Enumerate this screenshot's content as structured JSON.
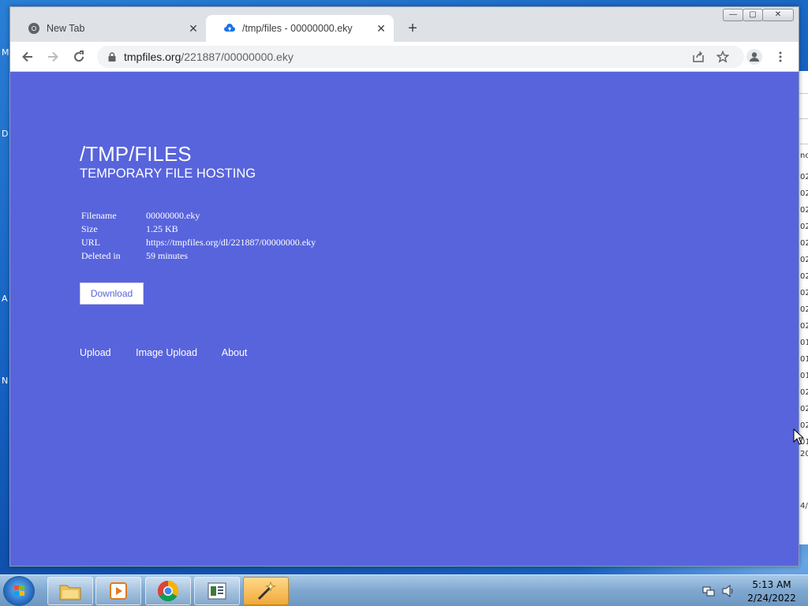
{
  "browser": {
    "tabs": [
      {
        "label": "New Tab",
        "icon": "chrome-icon"
      },
      {
        "label": "/tmp/files - 00000000.eky",
        "icon": "cloud-upload-icon",
        "active": true
      }
    ],
    "new_tab_label": "+",
    "url_domain": "tmpfiles.org",
    "url_path": "/221887/00000000.eky",
    "window_controls": [
      "minimize",
      "maximize",
      "close"
    ]
  },
  "page": {
    "title": "/TMP/FILES",
    "subtitle": "TEMPORARY FILE HOSTING",
    "file_info": [
      {
        "key": "Filename",
        "value": "00000000.eky"
      },
      {
        "key": "Size",
        "value": "1.25 KB"
      },
      {
        "key": "URL",
        "value": "https://tmpfiles.org/dl/221887/00000000.eky"
      },
      {
        "key": "Deleted in",
        "value": "59 minutes"
      }
    ],
    "download_label": "Download",
    "nav": [
      "Upload",
      "Image Upload",
      "About"
    ],
    "background_color": "#5864dc"
  },
  "taskbar": {
    "items": [
      "file-explorer-icon",
      "media-player-icon",
      "chrome-icon",
      "document-app-icon",
      "wizard-app-icon"
    ],
    "clock_time": "5:13 AM",
    "clock_date": "2/24/2022"
  },
  "desktop": {
    "edge_letters": [
      "M",
      "D",
      "A",
      "N"
    ],
    "bg_window_rows": [
      "no",
      "02",
      "02",
      "02",
      "02",
      "02",
      "02",
      "02",
      "02",
      "02",
      "02",
      "01",
      "01",
      "01",
      "02",
      "02",
      "02",
      "01",
      "20",
      "4/"
    ]
  }
}
